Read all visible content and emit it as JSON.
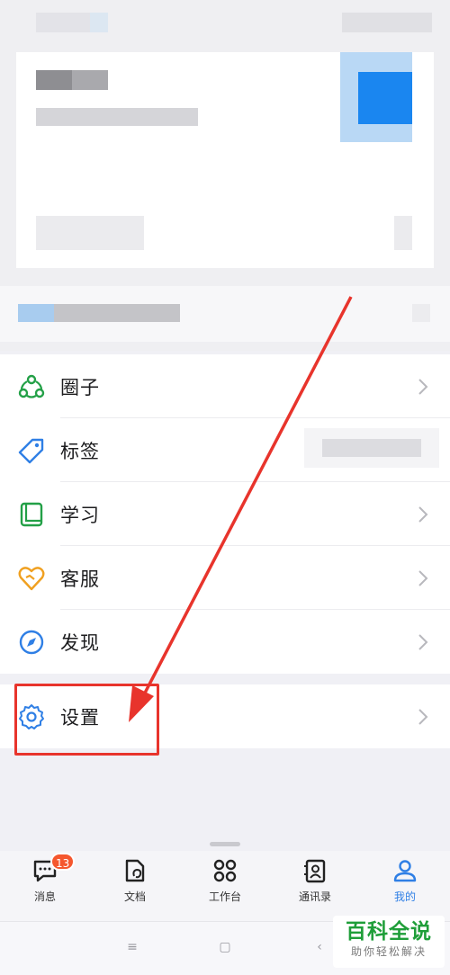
{
  "menu": {
    "items": [
      {
        "label": "圈子",
        "icon": "circle-icon"
      },
      {
        "label": "标签",
        "icon": "tag-icon"
      },
      {
        "label": "学习",
        "icon": "book-icon"
      },
      {
        "label": "客服",
        "icon": "heart-icon"
      },
      {
        "label": "发现",
        "icon": "compass-icon"
      }
    ],
    "settings": {
      "label": "设置",
      "icon": "gear-icon"
    }
  },
  "tabbar": {
    "tabs": [
      {
        "label": "消息",
        "icon": "message-icon",
        "badge": "13"
      },
      {
        "label": "文档",
        "icon": "document-icon"
      },
      {
        "label": "工作台",
        "icon": "workbench-icon"
      },
      {
        "label": "通讯录",
        "icon": "contacts-icon"
      },
      {
        "label": "我的",
        "icon": "profile-icon",
        "active": true
      }
    ]
  },
  "watermark": {
    "title": "百科全说",
    "subtitle": "助你轻松解决"
  },
  "colors": {
    "accent": "#2f7fe5",
    "highlight": "#e8342c",
    "badge": "#f5572e",
    "watermark": "#1f9e39"
  }
}
